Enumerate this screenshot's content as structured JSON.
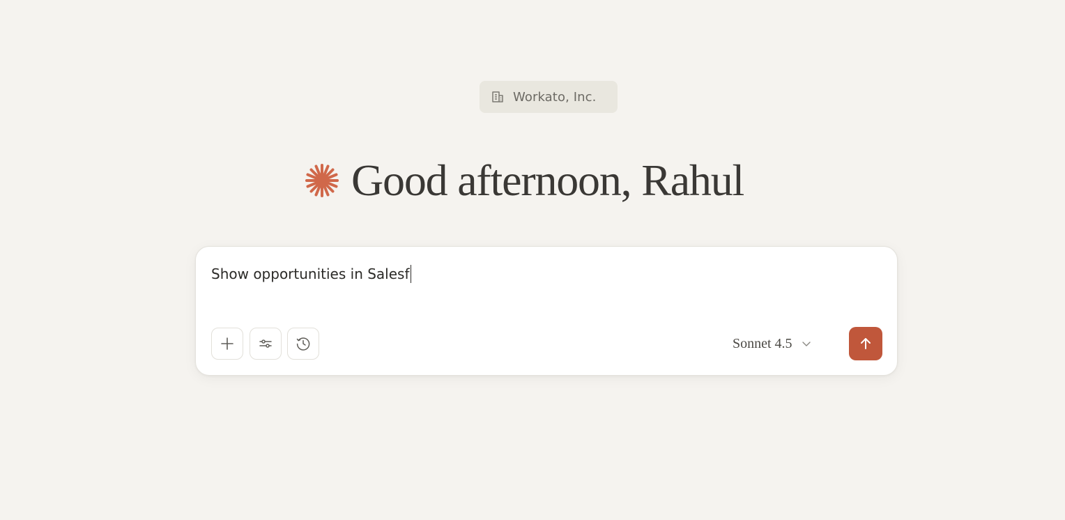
{
  "org_badge": {
    "label": "Workato, Inc.",
    "icon": "building-icon"
  },
  "greeting": {
    "text": "Good afternoon, Rahul",
    "icon": "spark-icon"
  },
  "composer": {
    "input_value": "Show opportunities in Salesf",
    "tools": [
      {
        "icon": "plus-icon"
      },
      {
        "icon": "sliders-icon"
      },
      {
        "icon": "clock-icon"
      }
    ],
    "model_label": "Sonnet 4.5",
    "model_icon": "chevron-down-icon",
    "send_icon": "arrow-up-icon"
  },
  "colors": {
    "background": "#f5f3ef",
    "accent": "#c0573b",
    "badge_bg": "#e9e7df"
  }
}
